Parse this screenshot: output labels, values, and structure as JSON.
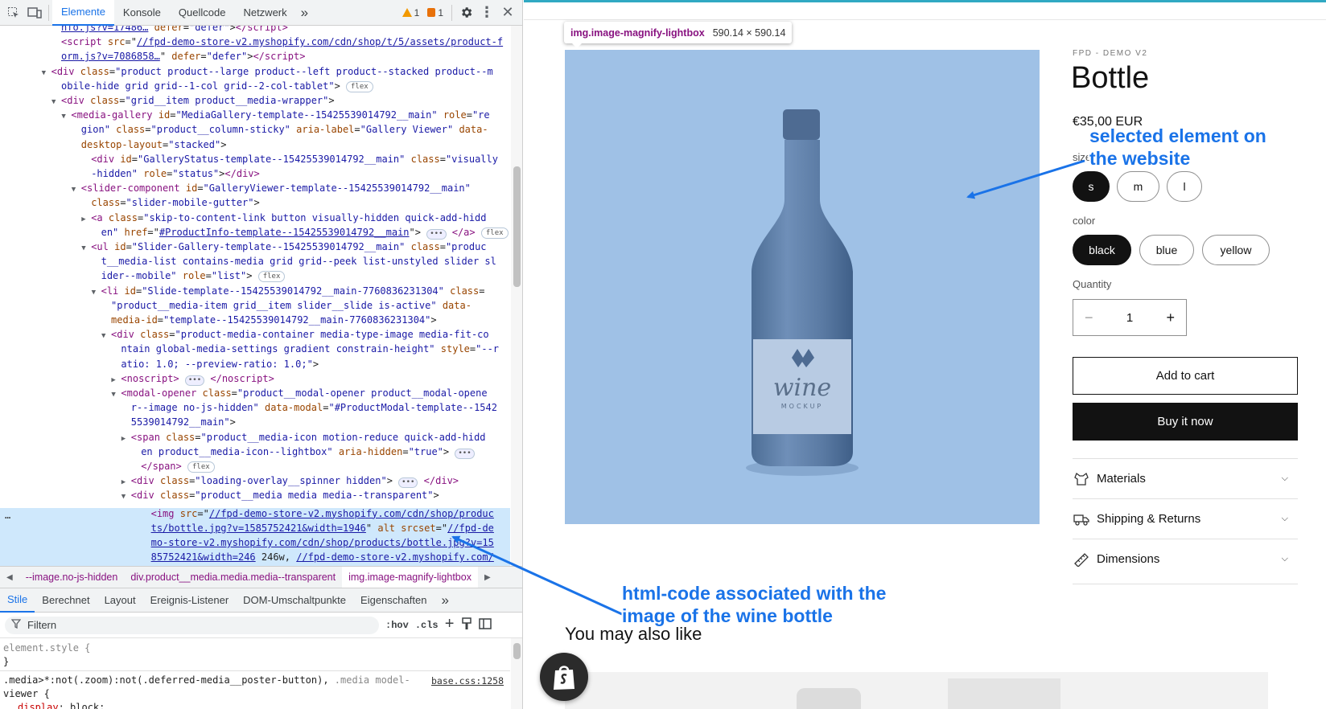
{
  "devtools": {
    "tabs": [
      "Elemente",
      "Konsole",
      "Quellcode",
      "Netzwerk"
    ],
    "more_tabs": "»",
    "warnings": "1",
    "errors": "1",
    "tree_lines": [
      {
        "d": 0,
        "html": "<span class=\"lk\">nfo.js?v=17486…</span> <span class=\"at\">defer</span>=<span class=\"av\">\"defer\"</span>&gt;<span class=\"tg\">&lt;/script&gt;</span>"
      },
      {
        "d": 0,
        "html": "<span class=\"tg\">&lt;script</span> <span class=\"at\">src</span>=\"<span class=\"lk\">//fpd-demo-store-v2.myshopify.com/cdn/shop/t/5/assets/product-f</span>"
      },
      {
        "d": 0,
        "html": "<span class=\"lk\">orm.js?v=7086858…</span>\" <span class=\"at\">defer</span>=<span class=\"av\">\"defer\"</span>&gt;<span class=\"tg\">&lt;/script&gt;</span>"
      },
      {
        "d": -1,
        "t": "▼",
        "html": "<span class=\"tg\">&lt;div</span> <span class=\"at\">class</span>=<span class=\"av\">\"product product--large product--left product--stacked product--m</span>"
      },
      {
        "d": 0,
        "html": "<span class=\"av\">obile-hide grid grid--1-col grid--2-col-tablet\"</span>&gt; <span class=\"fx\">flex</span>"
      },
      {
        "d": 0,
        "t": "▼",
        "html": "<span class=\"tg\">&lt;div</span> <span class=\"at\">class</span>=<span class=\"av\">\"grid__item product__media-wrapper\"</span>&gt;"
      },
      {
        "d": 1,
        "t": "▼",
        "html": "<span class=\"tg\">&lt;media-gallery</span> <span class=\"at\">id</span>=<span class=\"av\">\"MediaGallery-template--15425539014792__main\"</span> <span class=\"at\">role</span>=<span class=\"av\">\"re</span>"
      },
      {
        "d": 2,
        "html": "<span class=\"av\">gion\"</span> <span class=\"at\">class</span>=<span class=\"av\">\"product__column-sticky\"</span> <span class=\"at\">aria-label</span>=<span class=\"av\">\"Gallery Viewer\"</span> <span class=\"at\">data-</span>"
      },
      {
        "d": 2,
        "html": "<span class=\"at\">desktop-layout</span>=<span class=\"av\">\"stacked\"</span>&gt;"
      },
      {
        "d": 3,
        "html": "<span class=\"tg\">&lt;div</span> <span class=\"at\">id</span>=<span class=\"av\">\"GalleryStatus-template--15425539014792__main\"</span> <span class=\"at\">class</span>=<span class=\"av\">\"visually</span>"
      },
      {
        "d": 3,
        "html": "<span class=\"av\">-hidden\"</span> <span class=\"at\">role</span>=<span class=\"av\">\"status\"</span>&gt;<span class=\"tg\">&lt;/div&gt;</span>"
      },
      {
        "d": 2,
        "t": "▼",
        "html": "<span class=\"tg\">&lt;slider-component</span> <span class=\"at\">id</span>=<span class=\"av\">\"GalleryViewer-template--15425539014792__main\"</span>"
      },
      {
        "d": 3,
        "html": "<span class=\"at\">class</span>=<span class=\"av\">\"slider-mobile-gutter\"</span>&gt;"
      },
      {
        "d": 3,
        "t": "▶",
        "html": "<span class=\"tg\">&lt;a</span> <span class=\"at\">class</span>=<span class=\"av\">\"skip-to-content-link button visually-hidden quick-add-hidd</span>"
      },
      {
        "d": 4,
        "html": "<span class=\"av\">en\"</span> <span class=\"at\">href</span>=\"<span class=\"lk\">#ProductInfo-template--15425539014792__main</span>\"&gt; <span class=\"el\">•••</span> <span class=\"tg\">&lt;/a&gt;</span> <span class=\"fx\">flex</span>"
      },
      {
        "d": 3,
        "t": "▼",
        "html": "<span class=\"tg\">&lt;ul</span> <span class=\"at\">id</span>=<span class=\"av\">\"Slider-Gallery-template--15425539014792__main\"</span> <span class=\"at\">class</span>=<span class=\"av\">\"produc</span>"
      },
      {
        "d": 4,
        "html": "<span class=\"av\">t__media-list contains-media grid grid--peek list-unstyled slider sl</span>"
      },
      {
        "d": 4,
        "html": "<span class=\"av\">ider--mobile\"</span> <span class=\"at\">role</span>=<span class=\"av\">\"list\"</span>&gt; <span class=\"fx\">flex</span>"
      },
      {
        "d": 4,
        "t": "▼",
        "html": "<span class=\"tg\">&lt;li</span> <span class=\"at\">id</span>=<span class=\"av\">\"Slide-template--15425539014792__main-7760836231304\"</span> <span class=\"at\">class</span>="
      },
      {
        "d": 5,
        "html": "<span class=\"av\">\"product__media-item grid__item slider__slide is-active\"</span> <span class=\"at\">data-</span>"
      },
      {
        "d": 5,
        "html": "<span class=\"at\">media-id</span>=<span class=\"av\">\"template--15425539014792__main-7760836231304\"</span>&gt;"
      },
      {
        "d": 5,
        "t": "▼",
        "html": "<span class=\"tg\">&lt;div</span> <span class=\"at\">class</span>=<span class=\"av\">\"product-media-container media-type-image media-fit-co</span>"
      },
      {
        "d": 6,
        "html": "<span class=\"av\">ntain global-media-settings gradient constrain-height\"</span> <span class=\"at\">style</span>=<span class=\"av\">\"--r</span>"
      },
      {
        "d": 6,
        "html": "<span class=\"av\">atio: 1.0; --preview-ratio: 1.0;\"</span>&gt;"
      },
      {
        "d": 6,
        "t": "▶",
        "html": "<span class=\"tg\">&lt;noscript&gt;</span> <span class=\"el\">•••</span> <span class=\"tg\">&lt;/noscript&gt;</span>"
      },
      {
        "d": 6,
        "t": "▼",
        "html": "<span class=\"tg\">&lt;modal-opener</span> <span class=\"at\">class</span>=<span class=\"av\">\"product__modal-opener product__modal-opene</span>"
      },
      {
        "d": 7,
        "html": "<span class=\"av\">r--image no-js-hidden\"</span> <span class=\"at\">data-modal</span>=<span class=\"av\">\"#ProductModal-template--1542</span>"
      },
      {
        "d": 7,
        "html": "<span class=\"av\">5539014792__main\"</span>&gt;"
      },
      {
        "d": 7,
        "t": "▶",
        "html": "<span class=\"tg\">&lt;span</span> <span class=\"at\">class</span>=<span class=\"av\">\"product__media-icon motion-reduce quick-add-hidd</span>"
      },
      {
        "d": 8,
        "html": "<span class=\"av\">en product__media-icon--lightbox\"</span> <span class=\"at\">aria-hidden</span>=<span class=\"av\">\"true\"</span>&gt; <span class=\"el\">•••</span>"
      },
      {
        "d": 8,
        "html": "<span class=\"tg\">&lt;/span&gt;</span> <span class=\"fx\">flex</span>"
      },
      {
        "d": 7,
        "t": "▶",
        "html": "<span class=\"tg\">&lt;div</span> <span class=\"at\">class</span>=<span class=\"av\">\"loading-overlay__spinner hidden\"</span>&gt; <span class=\"el\">•••</span> <span class=\"tg\">&lt;/div&gt;</span>"
      },
      {
        "d": 7,
        "t": "▼",
        "html": "<span class=\"tg\">&lt;div</span> <span class=\"at\">class</span>=<span class=\"av\">\"product__media media media--transparent\"</span>&gt;"
      },
      {
        "d": 9,
        "html": "<span class=\"tg\">&lt;img</span> <span class=\"at\">src</span>=\"<span class=\"lk\">//fpd-demo-store-v2.myshopify.com/cdn/shop/produc</span>"
      },
      {
        "d": 9,
        "html": "<span class=\"lk\">ts/bottle.jpg?v=1585752421&amp;width=1946</span>\" <span class=\"at\">alt</span> <span class=\"at\">srcset</span>=\"<span class=\"lk\">//fpd-de</span>"
      },
      {
        "d": 9,
        "html": "<span class=\"lk\">mo-store-v2.myshopify.com/cdn/shop/products/bottle.jpg?v=15</span>"
      },
      {
        "d": 9,
        "html": "<span class=\"lk\">85752421&amp;width=246</span> 246w, <span class=\"lk\">//fpd-demo-store-v2.myshopify.com/</span>"
      }
    ],
    "breadcrumbs": [
      "--image.no-js-hidden",
      "div.product__media.media.media--transparent",
      "img.image-magnify-lightbox"
    ],
    "subtabs": [
      "Stile",
      "Berechnet",
      "Layout",
      "Ereignis-Listener",
      "DOM-Umschaltpunkte",
      "Eigenschaften"
    ],
    "filter_placeholder": "Filtern",
    "filter_tools": [
      ":hov",
      ".cls"
    ],
    "styles": {
      "element_style_open": "element.style {",
      "element_style_close": "}",
      "rule_selector": ".media>*:not(.zoom):not(.deferred-media__poster-button),",
      "rule_selector_gray": " .media model-",
      "rule_selector_2": "viewer {",
      "rule_source": "base.css:1258",
      "rule_prop": "display",
      "rule_value": "block;"
    }
  },
  "site": {
    "tooltip_name": "img.image-magnify-lightbox",
    "tooltip_size": "590.14 × 590.14",
    "vendor": "FPD - DEMO V2",
    "title": "Bottle",
    "price": "€35,00 EUR",
    "size_label": "size",
    "sizes": [
      "s",
      "m",
      "l"
    ],
    "selected_size": "s",
    "color_label": "color",
    "colors": [
      "black",
      "blue",
      "yellow"
    ],
    "selected_color": "black",
    "quantity_label": "Quantity",
    "quantity_value": "1",
    "add_to_cart": "Add to cart",
    "buy_now": "Buy it now",
    "accordion": [
      "Materials",
      "Shipping & Returns",
      "Dimensions"
    ],
    "also_like": "You may also like",
    "label_brand": "wine",
    "label_sub": "MOCKUP"
  },
  "annotations": {
    "website": "selected element on\nthe website",
    "code": "html-code associated with the\nimage of the wine bottle"
  },
  "colors": {
    "accent": "#1a73e8",
    "selection_overlay": "#9fc1e6",
    "devtools_highlight": "#cfe8fc"
  }
}
